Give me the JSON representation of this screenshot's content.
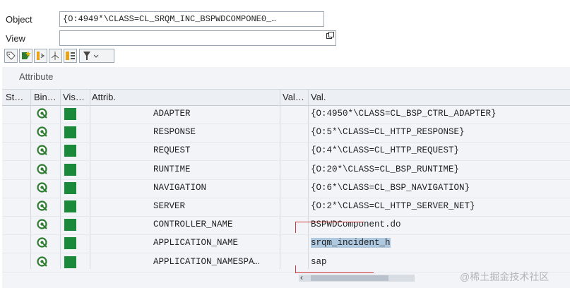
{
  "header": {
    "object_label": "Object",
    "object_value": "{O:4949*\\CLASS=CL_SRQM_INC_BSPWDCOMPONE0_…",
    "view_label": "View",
    "view_value": ""
  },
  "toolbar": {
    "icons": [
      "tag-icon",
      "bookmark-star-icon",
      "expand-icon",
      "hierarchy-icon",
      "layout-icon",
      "filter-icon"
    ]
  },
  "grid": {
    "title": "Attribute",
    "columns": [
      "St…",
      "Bin…",
      "Vis…",
      "Attrib.",
      "Val…",
      "Val."
    ],
    "rows": [
      {
        "attribute": "ADAPTER",
        "value": "{O:4950*\\CLASS=CL_BSP_CTRL_ADAPTER}"
      },
      {
        "attribute": "RESPONSE",
        "value": "{O:5*\\CLASS=CL_HTTP_RESPONSE}"
      },
      {
        "attribute": "REQUEST",
        "value": "{O:4*\\CLASS=CL_HTTP_REQUEST}"
      },
      {
        "attribute": "RUNTIME",
        "value": "{O:20*\\CLASS=CL_BSP_RUNTIME}"
      },
      {
        "attribute": "NAVIGATION",
        "value": "{O:6*\\CLASS=CL_BSP_NAVIGATION}"
      },
      {
        "attribute": "SERVER",
        "value": "{O:2*\\CLASS=CL_HTTP_SERVER_NET}"
      },
      {
        "attribute": "CONTROLLER_NAME",
        "value": "BSPWDComponent.do"
      },
      {
        "attribute": "APPLICATION_NAME",
        "value": "srqm_incident_h"
      },
      {
        "attribute": "APPLICATION_NAMESPA…",
        "value": "sap"
      }
    ]
  },
  "colors": {
    "visibility_green": "#1a8a3a",
    "binding_green": "#2f7d32",
    "highlight_red": "#d03a3a",
    "selection_blue": "#aec8e0"
  },
  "watermark": "@稀土掘金技术社区"
}
